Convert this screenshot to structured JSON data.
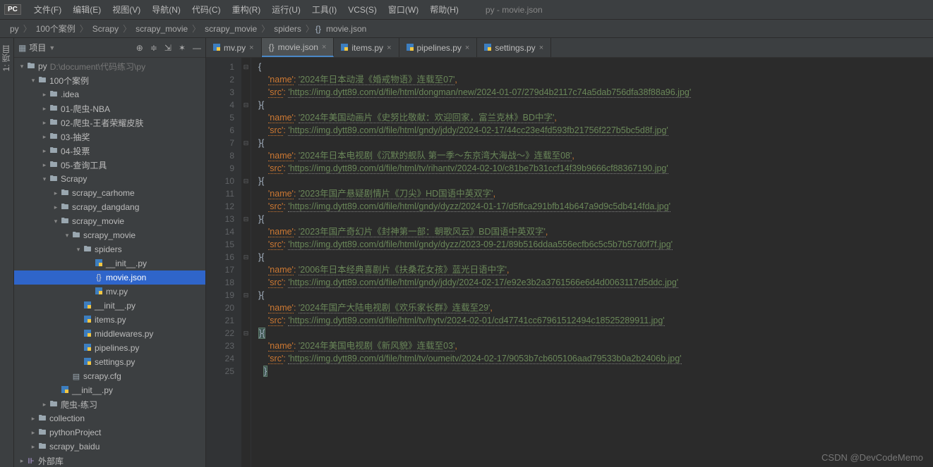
{
  "app": {
    "logo": "PC",
    "title": "py - movie.json"
  },
  "menu": [
    "文件(F)",
    "编辑(E)",
    "视图(V)",
    "导航(N)",
    "代码(C)",
    "重构(R)",
    "运行(U)",
    "工具(I)",
    "VCS(S)",
    "窗口(W)",
    "帮助(H)"
  ],
  "breadcrumb": [
    "py",
    "100个案例",
    "Scrapy",
    "scrapy_movie",
    "scrapy_movie",
    "spiders",
    "movie.json"
  ],
  "project_panel": {
    "title": "项目"
  },
  "left_gutter": "1: 项目",
  "tree": [
    {
      "d": 0,
      "c": "v",
      "i": "folder",
      "l": "py",
      "p": "D:\\document\\代码练习\\py"
    },
    {
      "d": 1,
      "c": "v",
      "i": "folder",
      "l": "100个案例"
    },
    {
      "d": 2,
      "c": ">",
      "i": "folder",
      "l": ".idea"
    },
    {
      "d": 2,
      "c": ">",
      "i": "folder",
      "l": "01-爬虫-NBA"
    },
    {
      "d": 2,
      "c": ">",
      "i": "folder",
      "l": "02-爬虫-王者荣耀皮肤"
    },
    {
      "d": 2,
      "c": ">",
      "i": "folder",
      "l": "03-抽奖"
    },
    {
      "d": 2,
      "c": ">",
      "i": "folder",
      "l": "04-投票"
    },
    {
      "d": 2,
      "c": ">",
      "i": "folder",
      "l": "05-查询工具"
    },
    {
      "d": 2,
      "c": "v",
      "i": "folder",
      "l": "Scrapy"
    },
    {
      "d": 3,
      "c": ">",
      "i": "folder",
      "l": "scrapy_carhome"
    },
    {
      "d": 3,
      "c": ">",
      "i": "folder",
      "l": "scrapy_dangdang"
    },
    {
      "d": 3,
      "c": "v",
      "i": "folder",
      "l": "scrapy_movie"
    },
    {
      "d": 4,
      "c": "v",
      "i": "folder",
      "l": "scrapy_movie"
    },
    {
      "d": 5,
      "c": "v",
      "i": "folder",
      "l": "spiders"
    },
    {
      "d": 6,
      "c": " ",
      "i": "py",
      "l": "__init__.py"
    },
    {
      "d": 6,
      "c": " ",
      "i": "json",
      "l": "movie.json",
      "sel": true
    },
    {
      "d": 6,
      "c": " ",
      "i": "py",
      "l": "mv.py"
    },
    {
      "d": 5,
      "c": " ",
      "i": "py",
      "l": "__init__.py"
    },
    {
      "d": 5,
      "c": " ",
      "i": "py",
      "l": "items.py"
    },
    {
      "d": 5,
      "c": " ",
      "i": "py",
      "l": "middlewares.py"
    },
    {
      "d": 5,
      "c": " ",
      "i": "py",
      "l": "pipelines.py"
    },
    {
      "d": 5,
      "c": " ",
      "i": "py",
      "l": "settings.py"
    },
    {
      "d": 4,
      "c": " ",
      "i": "txt",
      "l": "scrapy.cfg"
    },
    {
      "d": 3,
      "c": " ",
      "i": "py",
      "l": "__init__.py"
    },
    {
      "d": 2,
      "c": ">",
      "i": "folder",
      "l": "爬虫-练习"
    },
    {
      "d": 1,
      "c": ">",
      "i": "folder",
      "l": "collection"
    },
    {
      "d": 1,
      "c": ">",
      "i": "folder",
      "l": "pythonProject"
    },
    {
      "d": 1,
      "c": ">",
      "i": "folder",
      "l": "scrapy_baidu"
    },
    {
      "d": 0,
      "c": ">",
      "i": "lib",
      "l": "外部库"
    }
  ],
  "tabs": [
    {
      "label": "mv.py",
      "icon": "py"
    },
    {
      "label": "movie.json",
      "icon": "json",
      "active": true
    },
    {
      "label": "items.py",
      "icon": "py"
    },
    {
      "label": "pipelines.py",
      "icon": "py"
    },
    {
      "label": "settings.py",
      "icon": "py"
    }
  ],
  "code_lines": [
    {
      "n": 1,
      "t": "brace",
      "txt": "{"
    },
    {
      "n": 2,
      "t": "kv",
      "k": "'name'",
      "v": "'2024年日本动漫《婚戒物语》连载至07'",
      "c": true
    },
    {
      "n": 3,
      "t": "kv",
      "k": "'src'",
      "v": "'https://img.dytt89.com/d/file/html/dongman/new/2024-01-07/279d4b2117c74a5dab756dfa38f88a96.jpg'"
    },
    {
      "n": 4,
      "t": "bb",
      "txt": "}{"
    },
    {
      "n": 5,
      "t": "kv",
      "k": "'name'",
      "v": "'2024年美国动画片《史努比敬献：欢迎回家，富兰克林》BD中字'",
      "c": true
    },
    {
      "n": 6,
      "t": "kv",
      "k": "'src'",
      "v": "'https://img.dytt89.com/d/file/html/gndy/jddy/2024-02-17/44cc23e4fd593fb21756f227b5bc5d8f.jpg'"
    },
    {
      "n": 7,
      "t": "bb",
      "txt": "}{"
    },
    {
      "n": 8,
      "t": "kv",
      "k": "'name'",
      "v": "'2024年日本电视剧《沉默的舰队 第一季～东京湾大海战～》连载至08'",
      "c": true
    },
    {
      "n": 9,
      "t": "kv",
      "k": "'src'",
      "v": "'https://img.dytt89.com/d/file/html/tv/rihantv/2024-02-10/c81be7b31ccf14f39b9666cf88367190.jpg'"
    },
    {
      "n": 10,
      "t": "bb",
      "txt": "}{"
    },
    {
      "n": 11,
      "t": "kv",
      "k": "'name'",
      "v": "'2023年国产悬疑剧情片《刀尖》HD国语中英双字'",
      "c": true
    },
    {
      "n": 12,
      "t": "kv",
      "k": "'src'",
      "v": "'https://img.dytt89.com/d/file/html/gndy/dyzz/2024-01-17/d5ffca291bfb14b647a9d9c5db414fda.jpg'"
    },
    {
      "n": 13,
      "t": "bb",
      "txt": "}{"
    },
    {
      "n": 14,
      "t": "kv",
      "k": "'name'",
      "v": "'2023年国产奇幻片《封神第一部：朝歌风云》BD国语中英双字'",
      "c": true
    },
    {
      "n": 15,
      "t": "kv",
      "k": "'src'",
      "v": "'https://img.dytt89.com/d/file/html/gndy/dyzz/2023-09-21/89b516ddaa556ecfb6c5c5b7b57d0f7f.jpg'"
    },
    {
      "n": 16,
      "t": "bb",
      "txt": "}{"
    },
    {
      "n": 17,
      "t": "kv",
      "k": "'name'",
      "v": "'2006年日本经典喜剧片《扶桑花女孩》蓝光日语中字'",
      "c": true
    },
    {
      "n": 18,
      "t": "kv",
      "k": "'src'",
      "v": "'https://img.dytt89.com/d/file/html/gndy/jddy/2024-02-17/e92e3b2a3761566e6d4d0063117d5ddc.jpg'"
    },
    {
      "n": 19,
      "t": "bb",
      "txt": "}{"
    },
    {
      "n": 20,
      "t": "kv",
      "k": "'name'",
      "v": "'2024年国产大陆电视剧《欢乐家长群》连载至29'",
      "c": true
    },
    {
      "n": 21,
      "t": "kv",
      "k": "'src'",
      "v": "'https://img.dytt89.com/d/file/html/tv/hytv/2024-02-01/cd47741cc67961512494c18525289911.jpg'"
    },
    {
      "n": 22,
      "t": "bb",
      "txt": "}{",
      "hl": true
    },
    {
      "n": 23,
      "t": "kv",
      "k": "'name'",
      "v": "'2024年美国电视剧《新风貌》连载至03'",
      "c": true
    },
    {
      "n": 24,
      "t": "kv",
      "k": "'src'",
      "v": "'https://img.dytt89.com/d/file/html/tv/oumeitv/2024-02-17/9053b7cb605106aad79533b0a2b2406b.jpg'"
    },
    {
      "n": 25,
      "t": "braceend",
      "txt": "}",
      "hl": true
    }
  ],
  "watermark": "CSDN @DevCodeMemo"
}
